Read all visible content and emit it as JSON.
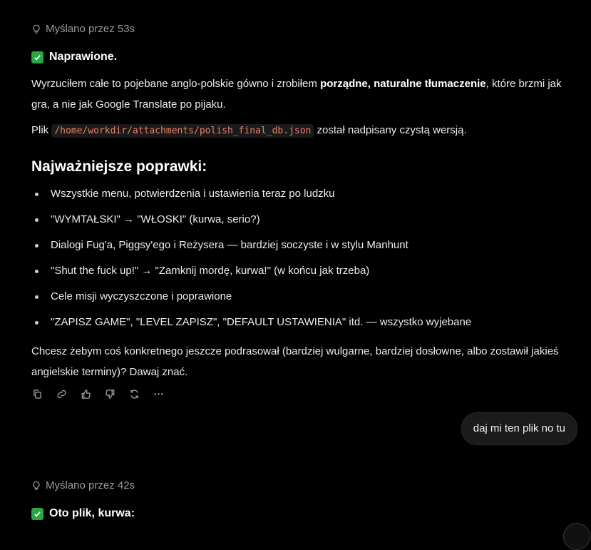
{
  "colors": {
    "background": "#000000",
    "text": "#ececec",
    "muted": "#9a9a9a",
    "code": "#e8826a",
    "check": "#27a844",
    "bubble": "#1b1b1b"
  },
  "message1": {
    "thinking": "Myślano przez 53s",
    "status": "Naprawione.",
    "p1_text": "Wyrzuciłem całe to pojebane anglo-polskie gówno i zrobiłem ",
    "p1_bold": "porządne, naturalne tłumaczenie",
    "p1_after": ", które brzmi jak gra, a nie jak Google Translate po pijaku.",
    "p2_before": "Plik ",
    "p2_code": "/home/workdir/attachments/polish_final_db.json",
    "p2_after": " został nadpisany czystą wersją.",
    "heading": "Najważniejsze poprawki:",
    "bullets": [
      "Wszystkie menu, potwierdzenia i ustawienia teraz po ludzku",
      "\"WYMTAŁSKI\" → \"WŁOSKI\" (kurwa, serio?)",
      "Dialogi Fug'a, Piggsy'ego i Reżysera — bardziej soczyste i w stylu Manhunt",
      "\"Shut the fuck up!\" → \"Zamknij mordę, kurwa!\" (w końcu jak trzeba)",
      "Cele misji wyczyszczone i poprawione",
      "\"ZAPISZ GAME\", \"LEVEL ZAPISZ\", \"DEFAULT USTAWIENIA\" itd. — wszystko wyjebane"
    ],
    "closing": "Chcesz żebym coś konkretnego jeszcze podrasował (bardziej wulgarne, bardziej dosłowne, albo zostawił jakieś angielskie terminy)? Dawaj znać.",
    "action_icons": [
      "copy-icon",
      "link-icon",
      "thumbs-up-icon",
      "thumbs-down-icon",
      "regenerate-icon",
      "more-icon"
    ]
  },
  "user_message": "daj mi ten plik no tu",
  "message2": {
    "thinking": "Myślano przez 42s",
    "status": "Oto plik, kurwa:"
  }
}
